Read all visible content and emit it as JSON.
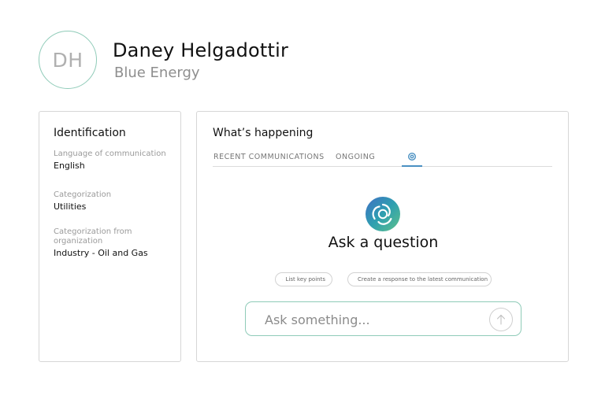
{
  "contact": {
    "initials": "DH",
    "name": "Daney Helgadottir",
    "company": "Blue Energy"
  },
  "identification": {
    "title": "Identification",
    "fields": [
      {
        "label": "Language of communication",
        "value": "English"
      },
      {
        "label": "Categorization",
        "value": "Utilities"
      },
      {
        "label": "Categorization from organization",
        "value": "Industry - Oil and Gas"
      }
    ]
  },
  "happening": {
    "title": "What’s happening",
    "tabs": [
      {
        "label": "RECENT COMMUNICATIONS"
      },
      {
        "label": "ONGOING"
      },
      {
        "icon": "ai-assistant-icon",
        "active": true
      }
    ]
  },
  "assistant": {
    "title": "Ask a question",
    "suggestions": [
      {
        "icon": "list-icon",
        "label": "List key points"
      },
      {
        "icon": "refresh-icon",
        "label": "Create a response to the latest communication"
      }
    ],
    "input_placeholder": "Ask something...",
    "send_icon": "arrow-up-icon"
  },
  "colors": {
    "accent_green": "#8fcbb8",
    "active_tab": "#4a90c2",
    "logo_teal": "#2e9fb0",
    "logo_blue": "#3f6fc4"
  }
}
